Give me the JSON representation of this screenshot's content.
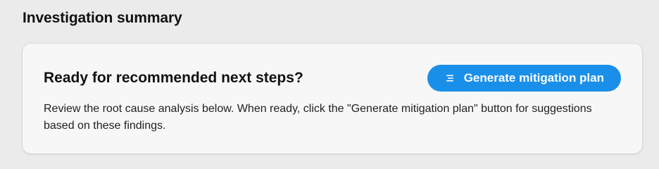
{
  "section": {
    "title": "Investigation summary"
  },
  "card": {
    "heading": "Ready for recommended next steps?",
    "body": "Review the root cause analysis below. When ready, click the \"Generate mitigation plan\" button for suggestions based on these findings.",
    "button": {
      "label": "Generate mitigation plan",
      "icon": "list-icon"
    }
  },
  "colors": {
    "page_background": "#ebebeb",
    "card_background": "#f7f7f7",
    "accent": "#1a8fea",
    "text": "#111111"
  }
}
